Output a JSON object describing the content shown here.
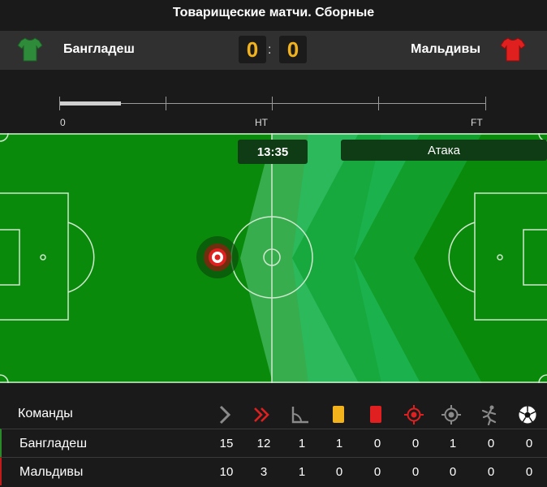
{
  "header": {
    "competition": "Товарищеские матчи. Сборные"
  },
  "teams": {
    "home": {
      "name": "Бангладеш",
      "score": "0",
      "jersey_color": "#2e8b3a"
    },
    "away": {
      "name": "Мальдивы",
      "score": "0",
      "jersey_color": "#d91b1b"
    },
    "separator": ":"
  },
  "timeline": {
    "progress_fraction": 0.145,
    "labels": {
      "start": "0",
      "half": "HT",
      "end": "FT"
    }
  },
  "pitch": {
    "clock": "13:35",
    "status": "Атака",
    "attack_color": "#23c36a"
  },
  "stats": {
    "header_label": "Команды",
    "columns": [
      "attack-icon",
      "dangerous-attack-icon",
      "corner-icon",
      "yellow-card-icon",
      "red-card-icon",
      "shot-on-target-icon",
      "shot-off-target-icon",
      "substitution-icon",
      "goal-icon"
    ],
    "rows": [
      {
        "team": "Бангладеш",
        "values": [
          "15",
          "12",
          "1",
          "1",
          "0",
          "0",
          "1",
          "0",
          "0"
        ]
      },
      {
        "team": "Мальдивы",
        "values": [
          "10",
          "3",
          "1",
          "0",
          "0",
          "0",
          "0",
          "0",
          "0"
        ]
      }
    ]
  }
}
